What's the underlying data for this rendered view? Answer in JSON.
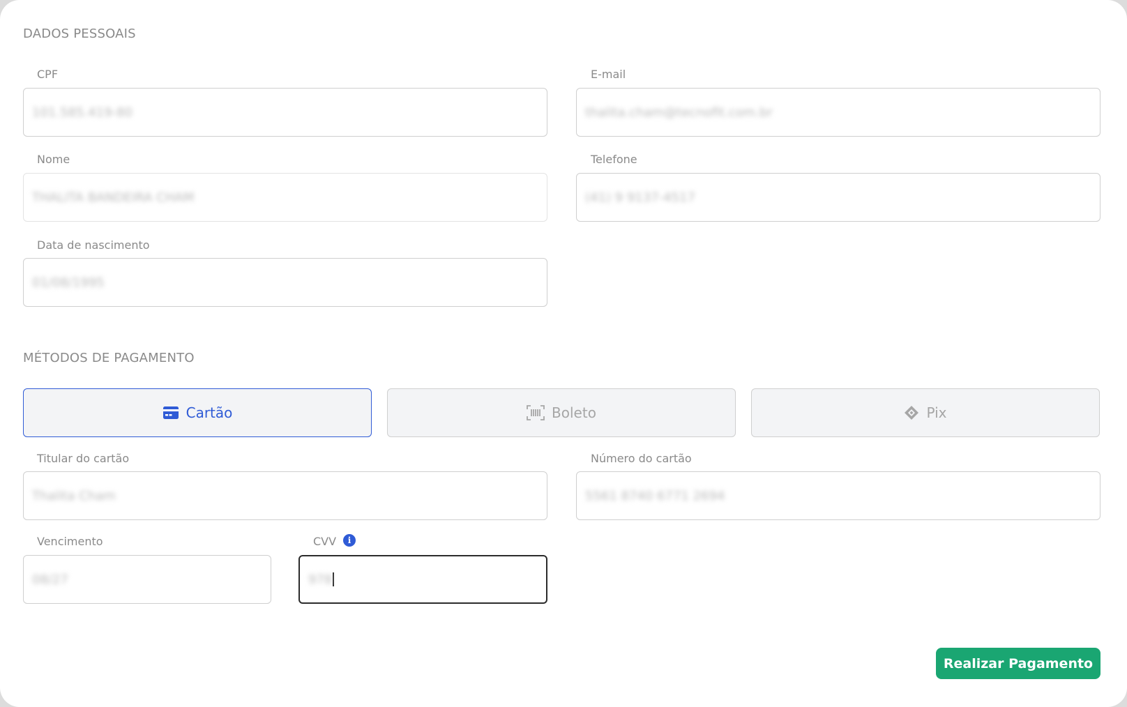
{
  "personal": {
    "section_title": "DADOS PESSOAIS",
    "cpf": {
      "label": "CPF",
      "value": "101.585.419-80"
    },
    "email": {
      "label": "E-mail",
      "value": "thalita.cham@tecnofit.com.br"
    },
    "nome": {
      "label": "Nome",
      "value": "THALITA BANDEIRA CHAM"
    },
    "telefone": {
      "label": "Telefone",
      "value": "(41) 9 9137-4517"
    },
    "nascimento": {
      "label": "Data de nascimento",
      "value": "01/08/1995"
    }
  },
  "payment": {
    "section_title": "MÉTODOS DE PAGAMENTO",
    "tabs": [
      {
        "label": "Cartão",
        "icon": "credit-card-icon",
        "active": true
      },
      {
        "label": "Boleto",
        "icon": "barcode-icon",
        "active": false
      },
      {
        "label": "Pix",
        "icon": "pix-icon",
        "active": false
      }
    ],
    "titular": {
      "label": "Titular do cartão",
      "value": "Thalita Cham"
    },
    "numero": {
      "label": "Número do cartão",
      "value": "5561 8740 6771 2694"
    },
    "vencimento": {
      "label": "Vencimento",
      "value": "08/27"
    },
    "cvv": {
      "label": "CVV",
      "value": "978",
      "info_icon": "info-icon"
    }
  },
  "actions": {
    "submit_label": "Realizar Pagamento"
  },
  "colors": {
    "accent": "#2f5bd6",
    "submit": "#1aa672"
  }
}
